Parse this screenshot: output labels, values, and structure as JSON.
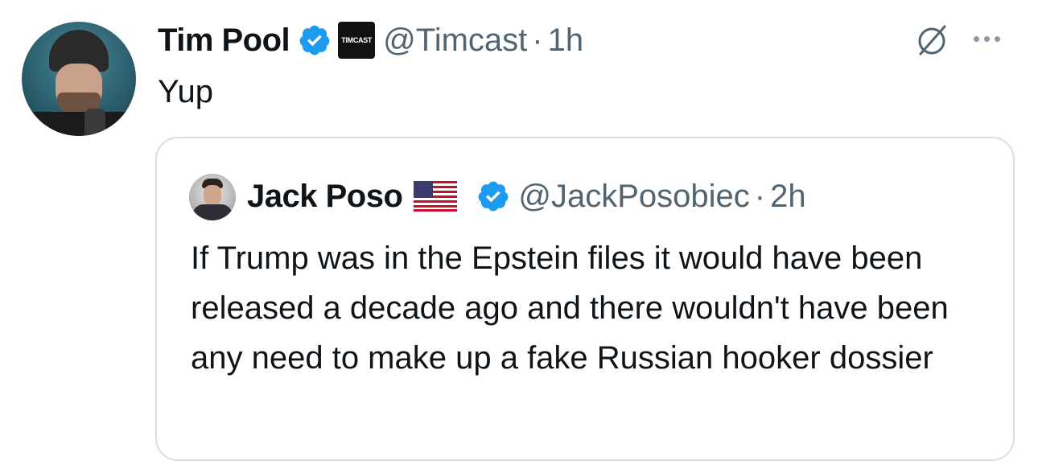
{
  "tweet": {
    "author_name": "Tim Pool",
    "affiliate_badge": "TIMCAST",
    "handle": "@Timcast",
    "separator": "·",
    "time": "1h",
    "text": "Yup"
  },
  "quoted_tweet": {
    "author_name": "Jack Poso",
    "flag_icon": "us-flag-icon",
    "handle": "@JackPosobiec",
    "separator": "·",
    "time": "2h",
    "text": "If Trump was in the Epstein files it would have been released a decade ago and there wouldn't have been any need to make up a fake Russian hooker dossier"
  },
  "colors": {
    "verified_blue": "#1d9bf0",
    "secondary_text": "#536471",
    "border": "#d9dee2"
  }
}
